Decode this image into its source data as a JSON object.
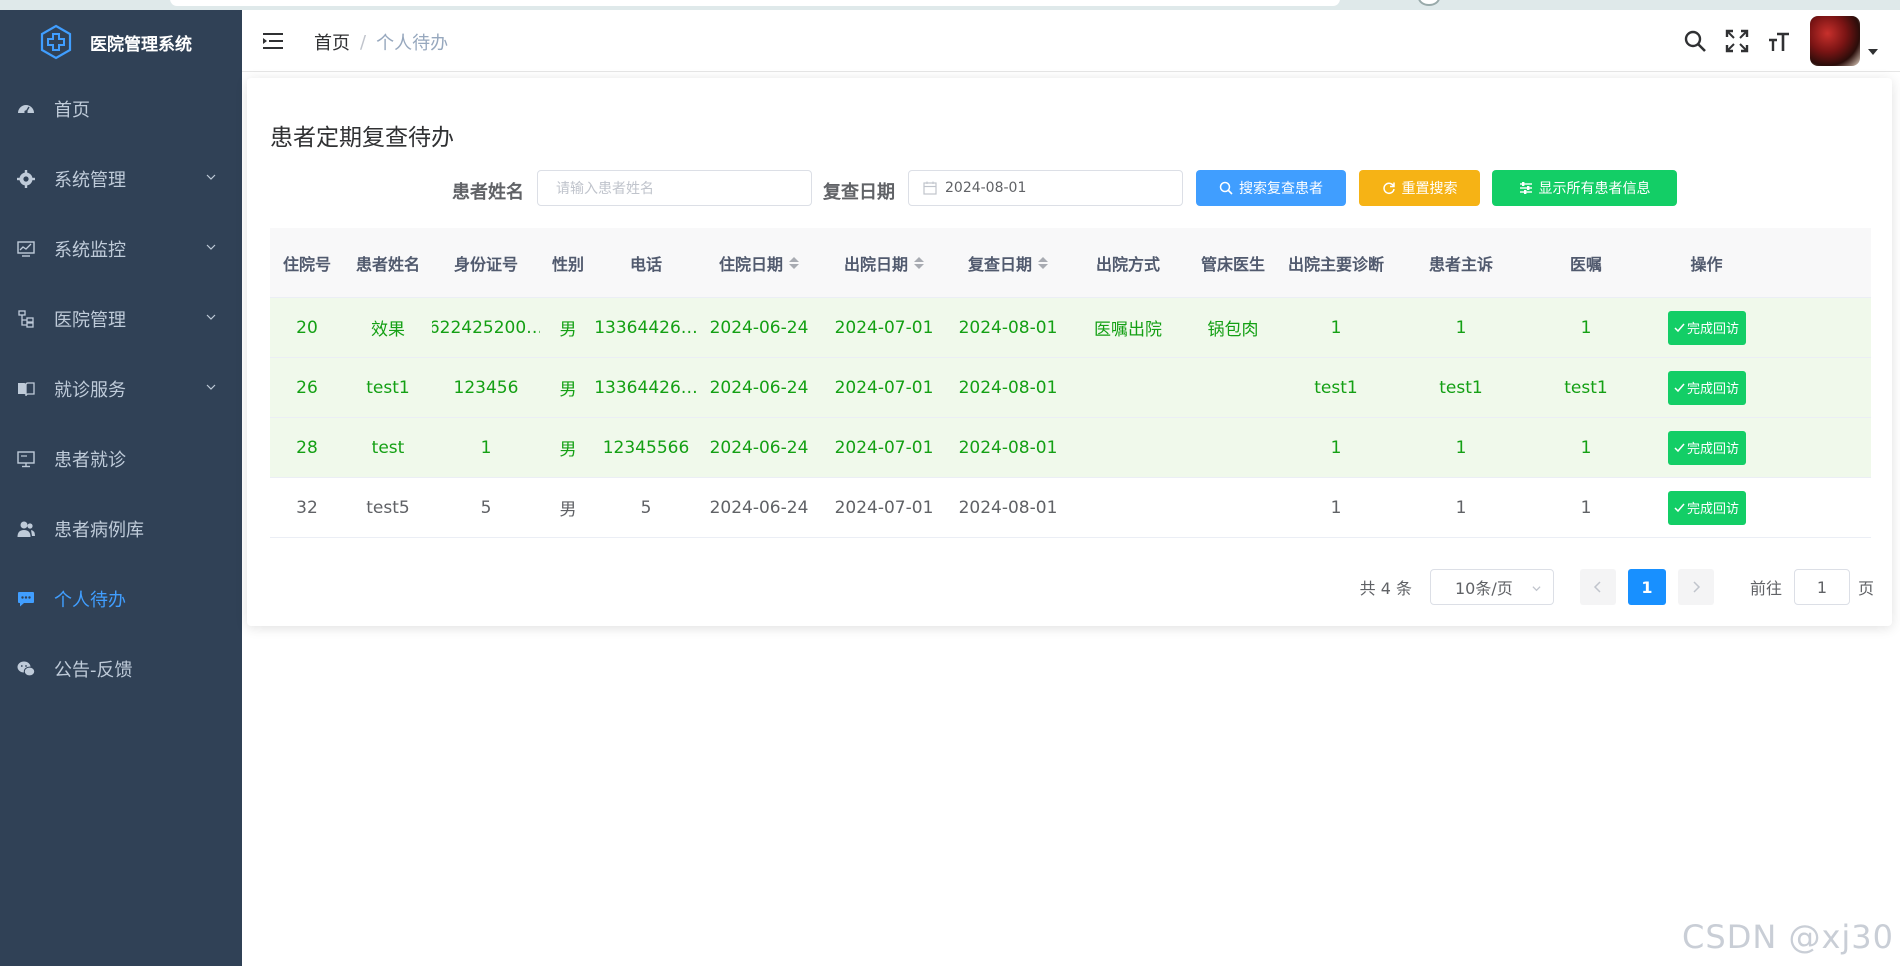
{
  "app": {
    "title": "医院管理系统"
  },
  "sidebar": {
    "items": [
      {
        "label": "首页",
        "icon": "dashboard-icon",
        "expandable": false,
        "active": false
      },
      {
        "label": "系统管理",
        "icon": "gear-icon",
        "expandable": true,
        "active": false
      },
      {
        "label": "系统监控",
        "icon": "monitor-icon",
        "expandable": true,
        "active": false
      },
      {
        "label": "医院管理",
        "icon": "tree-icon",
        "expandable": true,
        "active": false
      },
      {
        "label": "就诊服务",
        "icon": "book-icon",
        "expandable": true,
        "active": false
      },
      {
        "label": "患者就诊",
        "icon": "screen-icon",
        "expandable": false,
        "active": false
      },
      {
        "label": "患者病例库",
        "icon": "people-icon",
        "expandable": false,
        "active": false
      },
      {
        "label": "个人待办",
        "icon": "message-icon",
        "expandable": false,
        "active": true
      },
      {
        "label": "公告-反馈",
        "icon": "wechat-icon",
        "expandable": false,
        "active": false
      }
    ],
    "active_color": "#409eff"
  },
  "header": {
    "breadcrumb": [
      "首页",
      "个人待办"
    ],
    "tools": [
      "search-icon",
      "fullscreen-icon",
      "font-size-icon"
    ]
  },
  "page": {
    "title": "患者定期复查待办",
    "search": {
      "name_label": "患者姓名",
      "name_placeholder": "请输入患者姓名",
      "date_label": "复查日期",
      "date_value": "2024-08-01",
      "search_button": "搜索复查患者",
      "reset_button": "重置搜索",
      "show_all_button": "显示所有患者信息"
    }
  },
  "table": {
    "columns": [
      "住院号",
      "患者姓名",
      "身份证号",
      "性别",
      "电话",
      "住院日期",
      "出院日期",
      "复查日期",
      "出院方式",
      "管床医生",
      "出院主要诊断",
      "患者主诉",
      "医嘱",
      "操作"
    ],
    "rows": [
      {
        "cells": [
          "20",
          "效果",
          "622425200…",
          "男",
          "13364426…",
          "2024-06-24",
          "2024-07-01",
          "2024-08-01",
          "医嘱出院",
          "锅包肉",
          "1",
          "1",
          "1"
        ],
        "highlight": true
      },
      {
        "cells": [
          "26",
          "test1",
          "123456",
          "男",
          "13364426…",
          "2024-06-24",
          "2024-07-01",
          "2024-08-01",
          "",
          "",
          "test1",
          "test1",
          "test1"
        ],
        "highlight": true
      },
      {
        "cells": [
          "28",
          "test",
          "1",
          "男",
          "12345566",
          "2024-06-24",
          "2024-07-01",
          "2024-08-01",
          "",
          "",
          "1",
          "1",
          "1"
        ],
        "highlight": true
      },
      {
        "cells": [
          "32",
          "test5",
          "5",
          "男",
          "5",
          "2024-06-24",
          "2024-07-01",
          "2024-08-01",
          "",
          "",
          "1",
          "1",
          "1"
        ],
        "highlight": false
      }
    ],
    "action_label": "完成回访"
  },
  "pagination": {
    "total": "共 4 条",
    "page_size": "10条/页",
    "current_page": "1",
    "goto_prefix": "前往",
    "goto_value": "1",
    "goto_suffix": "页"
  },
  "watermark": "CSDN @xj30"
}
